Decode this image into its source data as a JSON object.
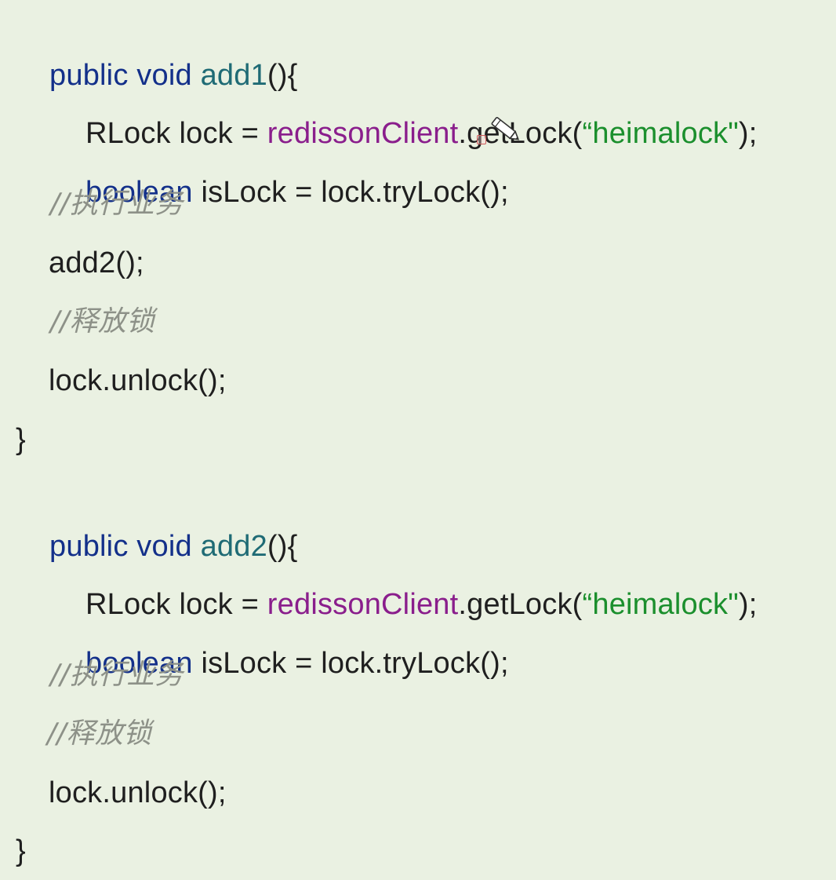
{
  "code": {
    "method1": {
      "keyword_public": "public",
      "keyword_void": "void",
      "name": "add1",
      "signature_tail": "(){",
      "line_rlock_type": "RLock lock = ",
      "line_rlock_obj": "redissonClient",
      "line_rlock_call": ".getLock(",
      "line_rlock_str": "“heimalock\"",
      "line_rlock_end": ");",
      "line_bool_kw": "boolean",
      "line_bool_rest": " isLock = lock.tryLock();",
      "comment_exec": "//执行业务",
      "call_add2": "add2();",
      "comment_release": "//释放锁",
      "unlock": "lock.unlock();",
      "close_brace": "}"
    },
    "method2": {
      "keyword_public": "public",
      "keyword_void": "void",
      "name": "add2",
      "signature_tail": "(){",
      "line_rlock_type": "RLock lock = ",
      "line_rlock_obj": "redissonClient",
      "line_rlock_call": ".getLock(",
      "line_rlock_str": "“heimalock\"",
      "line_rlock_end": ");",
      "line_bool_kw": "boolean",
      "line_bool_rest": " isLock = lock.tryLock();",
      "comment_exec": "//执行业务",
      "comment_release": "//释放锁",
      "unlock": "lock.unlock();",
      "close_brace": "}"
    }
  },
  "colors": {
    "background": "#eaf1e2",
    "keyword": "#13308a",
    "method_name": "#1f6b75",
    "object": "#8a1e8c",
    "string": "#1b8f2d",
    "comment": "#8d9188"
  },
  "icons": {
    "pointer": "pencil-icon"
  }
}
